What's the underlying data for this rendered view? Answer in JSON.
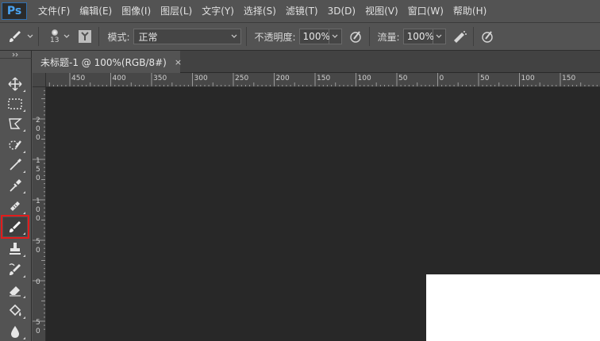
{
  "app": {
    "logo": "Ps"
  },
  "menu": [
    "文件(F)",
    "编辑(E)",
    "图像(I)",
    "图层(L)",
    "文字(Y)",
    "选择(S)",
    "滤镜(T)",
    "3D(D)",
    "视图(V)",
    "窗口(W)",
    "帮助(H)"
  ],
  "options": {
    "brush_size": "13",
    "mode_label": "模式:",
    "mode_value": "正常",
    "opacity_label": "不透明度:",
    "opacity_value": "100%",
    "flow_label": "流量:",
    "flow_value": "100%"
  },
  "document": {
    "tab_title": "未标题-1 @ 100%(RGB/8#)",
    "close_glyph": "×"
  },
  "ruler": {
    "top_labels": [
      "450",
      "400",
      "350",
      "300",
      "250",
      "200",
      "150",
      "100",
      "50",
      "0",
      "50",
      "100",
      "150",
      "200"
    ],
    "left_groups": [
      [
        "2",
        "0",
        "0"
      ],
      [
        "1",
        "5",
        "0"
      ],
      [
        "1",
        "0",
        "0"
      ],
      [
        "5",
        "0"
      ],
      [
        "0"
      ],
      [
        "5",
        "0"
      ]
    ]
  },
  "tools": [
    "move-tool",
    "marquee-tool",
    "lasso-tool",
    "quick-selection-tool",
    "crop-tool",
    "eyedropper-tool",
    "healing-brush-tool",
    "brush-tool",
    "clone-stamp-tool",
    "history-brush-tool",
    "eraser-tool",
    "paint-bucket-tool",
    "blur-tool"
  ],
  "selected_tool": "brush-tool",
  "colors": {
    "accent_selected": "#e21b1b",
    "ps_blue": "#4aa3f0",
    "workspace": "#282828",
    "canvas": "#ffffff"
  }
}
